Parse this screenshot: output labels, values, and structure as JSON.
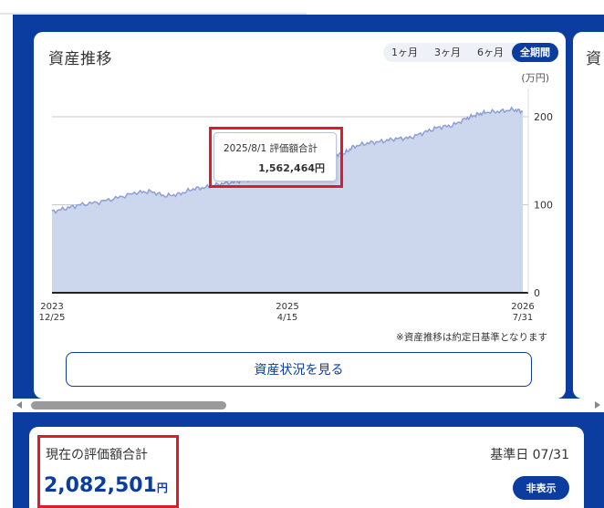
{
  "colors": {
    "brand": "#0b3ca0",
    "area_fill": "#ccd7ee",
    "area_line": "#8d9fd6",
    "highlight": "#e0192b"
  },
  "asset_card": {
    "title": "資産推移",
    "period_tabs": [
      {
        "label": "1ヶ月",
        "active": false
      },
      {
        "label": "3ヶ月",
        "active": false
      },
      {
        "label": "6ヶ月",
        "active": false
      },
      {
        "label": "全期間",
        "active": true
      }
    ],
    "unit": "(万円)",
    "tooltip": {
      "label": "2025/8/1 評価額合計",
      "value": "1,562,464円"
    },
    "note": "※資産推移は約定日基準となります",
    "view_button": "資産状況を見る"
  },
  "next_card": {
    "title": "資"
  },
  "summary_card": {
    "label": "現在の評価額合計",
    "date_label": "基準日 07/31",
    "value": "2,082,501",
    "value_unit": "円",
    "hide_button": "非表示"
  },
  "chart_data": {
    "type": "area",
    "ylabel": "(万円)",
    "ylim": [
      0,
      230
    ],
    "y_ticks": [
      0,
      100,
      200
    ],
    "x_tick_labels": [
      {
        "year": "2023",
        "date": "12/25",
        "t": 0
      },
      {
        "year": "2025",
        "date": "4/15",
        "t": 0.5
      },
      {
        "year": "2026",
        "date": "7/31",
        "t": 1
      }
    ],
    "series": [
      {
        "values": [
          [
            0,
            92
          ],
          [
            0.03,
            96
          ],
          [
            0.06,
            100
          ],
          [
            0.1,
            103
          ],
          [
            0.14,
            108
          ],
          [
            0.18,
            114
          ],
          [
            0.21,
            115
          ],
          [
            0.24,
            110
          ],
          [
            0.27,
            112
          ],
          [
            0.3,
            118
          ],
          [
            0.33,
            120
          ],
          [
            0.36,
            124
          ],
          [
            0.39,
            126
          ],
          [
            0.42,
            129
          ],
          [
            0.45,
            133
          ],
          [
            0.48,
            136
          ],
          [
            0.5,
            134
          ],
          [
            0.52,
            138
          ],
          [
            0.55,
            146
          ],
          [
            0.58,
            152
          ],
          [
            0.6,
            156
          ],
          [
            0.62,
            158
          ],
          [
            0.64,
            166
          ],
          [
            0.67,
            170
          ],
          [
            0.7,
            172
          ],
          [
            0.73,
            175
          ],
          [
            0.76,
            176
          ],
          [
            0.79,
            182
          ],
          [
            0.82,
            188
          ],
          [
            0.85,
            190
          ],
          [
            0.88,
            198
          ],
          [
            0.9,
            202
          ],
          [
            0.92,
            205
          ],
          [
            0.95,
            206
          ],
          [
            0.98,
            208
          ],
          [
            1,
            206
          ]
        ]
      }
    ],
    "grid": true
  }
}
